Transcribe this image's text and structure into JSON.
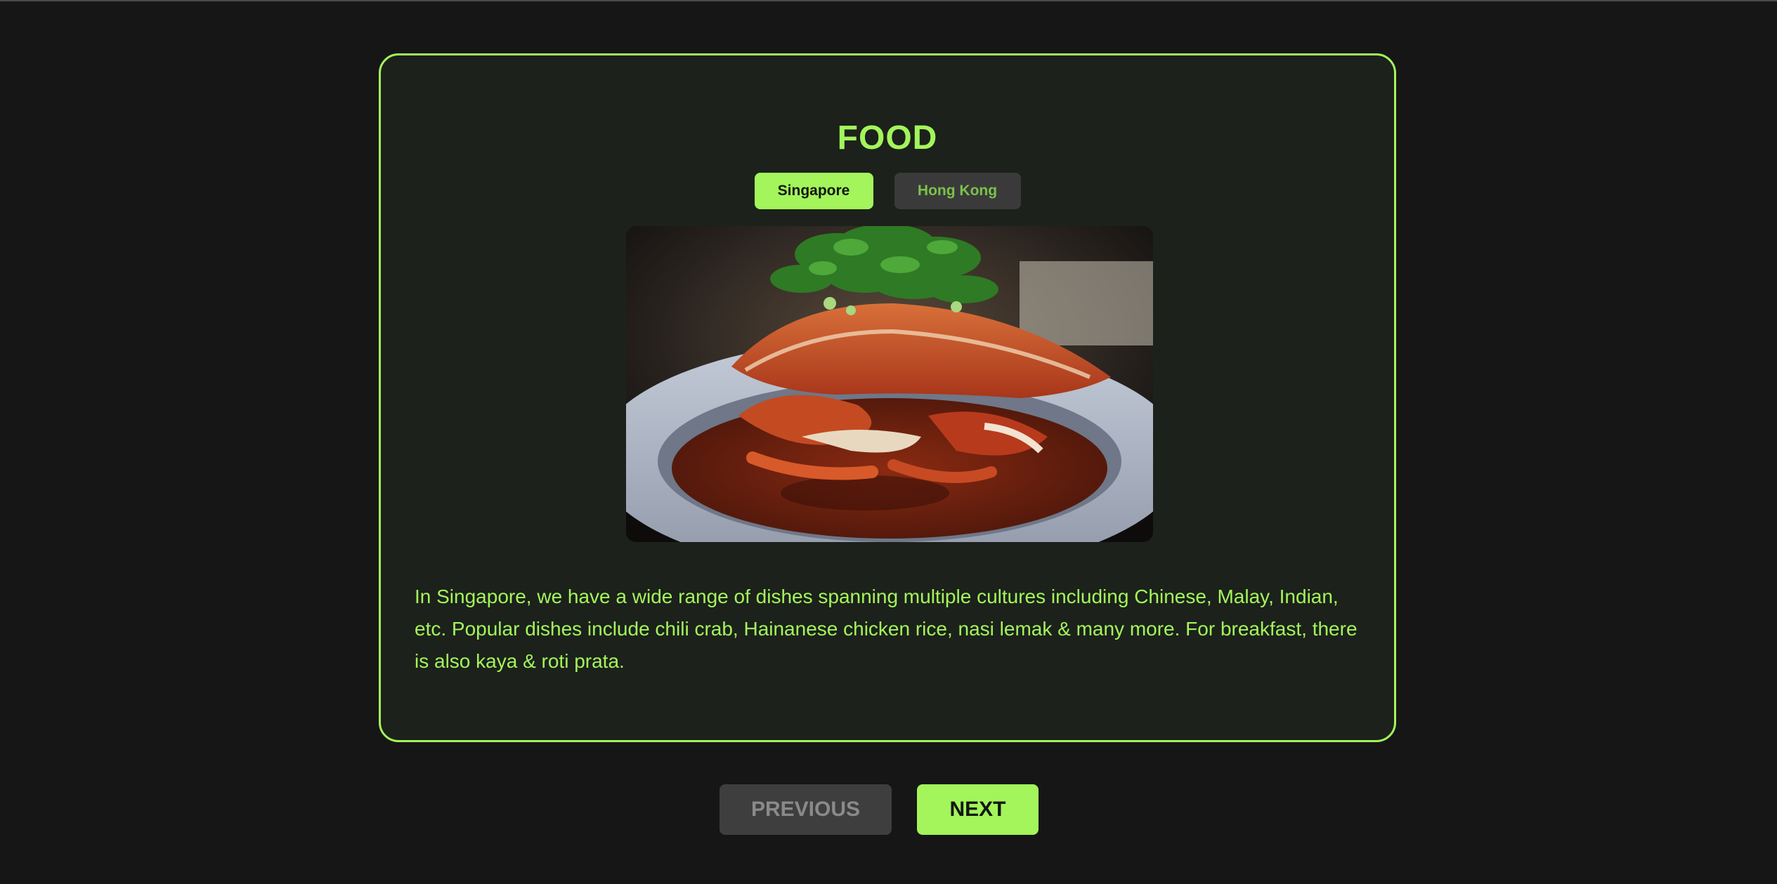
{
  "section": {
    "title": "FOOD"
  },
  "tabs": [
    {
      "label": "Singapore",
      "active": true
    },
    {
      "label": "Hong Kong",
      "active": false
    }
  ],
  "image": {
    "subject": "chili crab dish"
  },
  "description": "In Singapore, we have a wide range of dishes spanning multiple cultures including Chinese, Malay, Indian, etc. Popular dishes include chili crab, Hainanese chicken rice, nasi lemak & many more. For breakfast, there is also kaya & roti prata.",
  "navigation": {
    "previous_label": "PREVIOUS",
    "next_label": "NEXT"
  },
  "colors": {
    "accent": "#a3f55b",
    "background": "#161616",
    "card": "#1c211b",
    "inactive": "#3a3a3a"
  }
}
